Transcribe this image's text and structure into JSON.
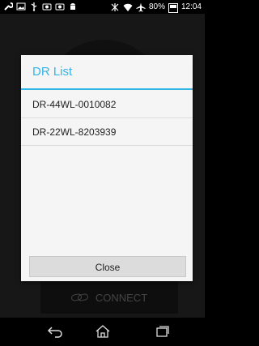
{
  "status_bar": {
    "battery": "80%",
    "time": "12:04",
    "icons": [
      "wrench-icon",
      "image-icon",
      "usb-icon",
      "camera-icon",
      "camera-icon",
      "android-icon",
      "vibrate-icon",
      "wifi-icon",
      "airplane-icon",
      "battery-icon"
    ]
  },
  "background": {
    "connect_label": "CONNECT"
  },
  "dialog": {
    "title": "DR List",
    "items": [
      "DR-44WL-0010082",
      "DR-22WL-8203939"
    ],
    "close_label": "Close"
  },
  "nav": {
    "icons": [
      "back-icon",
      "home-icon",
      "recent-apps-icon"
    ]
  },
  "colors": {
    "accent": "#33b5e5",
    "dialog_bg": "#f5f5f5",
    "button_bg": "#dcdcdc"
  }
}
